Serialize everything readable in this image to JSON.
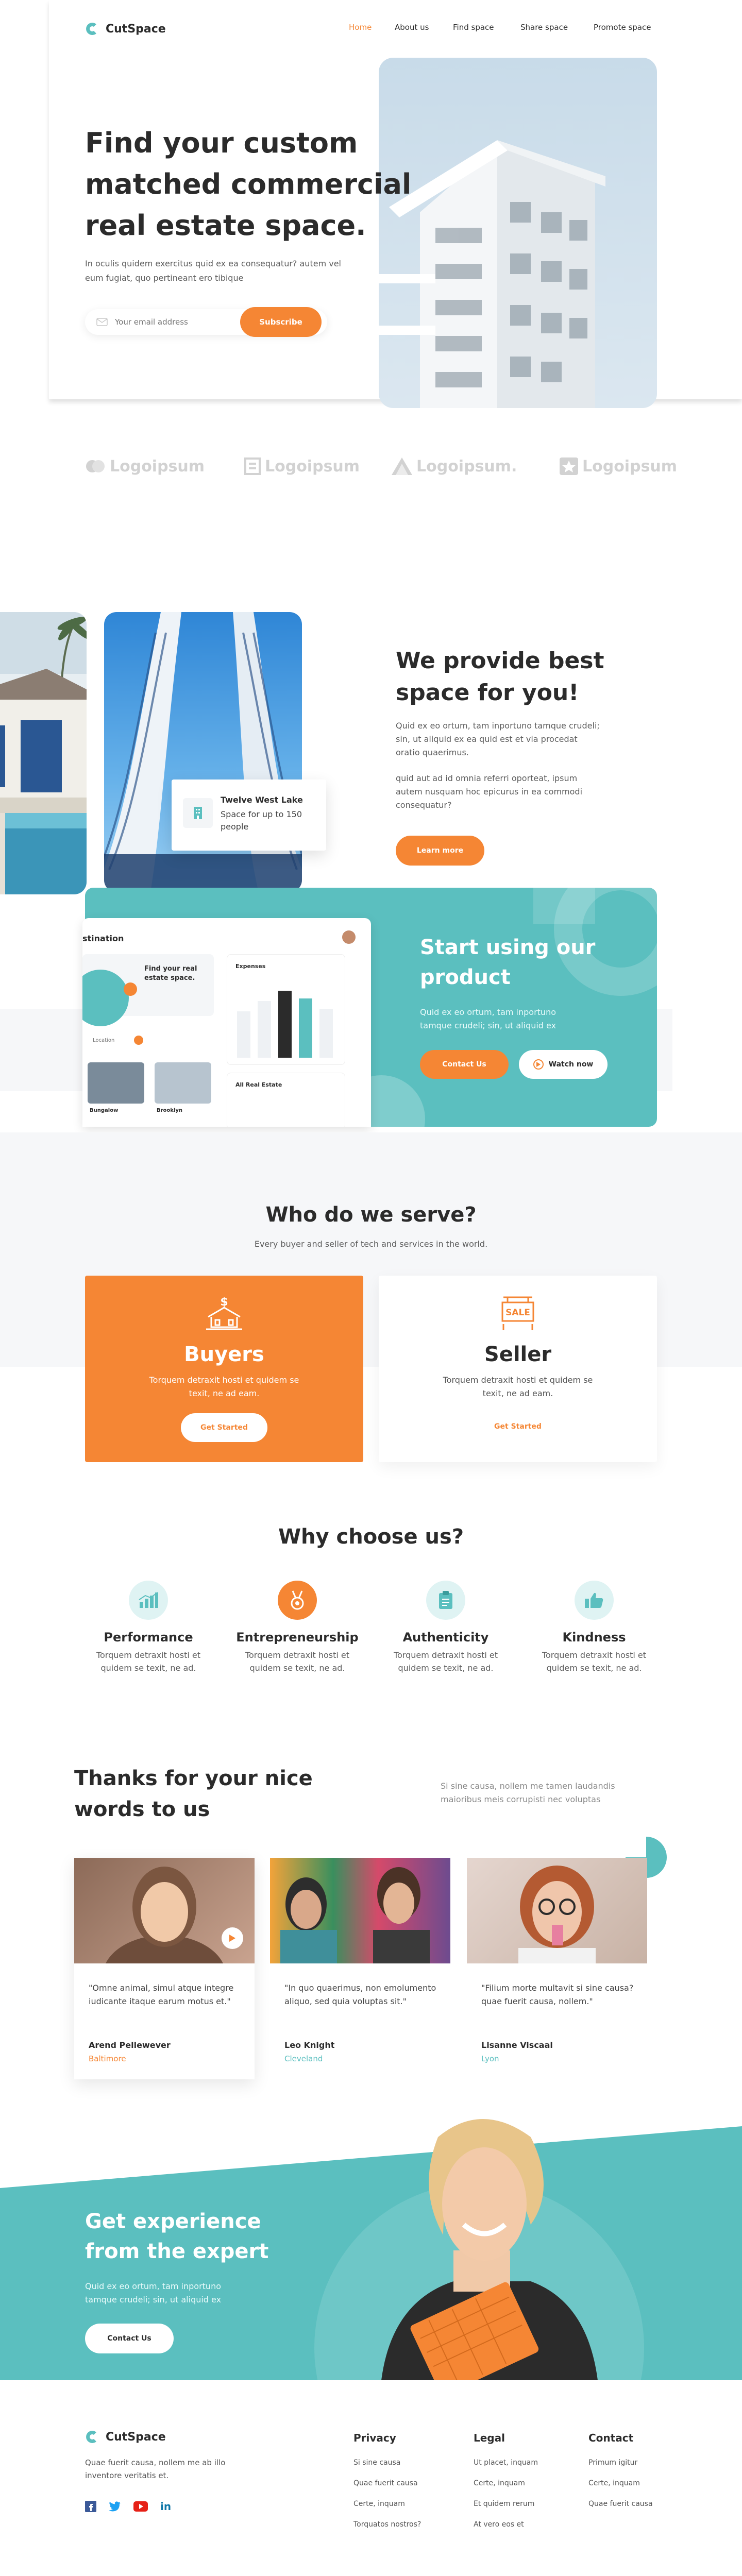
{
  "brand": {
    "name": "CutSpace"
  },
  "nav": {
    "items": [
      "Home",
      "About us",
      "Find space",
      "Share space",
      "Promote space"
    ]
  },
  "hero": {
    "title_lines": [
      "Find your custom",
      "matched commercial",
      "real estate space."
    ],
    "text": "In oculis quidem exercitus quid ex ea consequatur? autem vel eum fugiat, quo pertineant ero tibique",
    "email_placeholder": "Your email address",
    "subscribe_label": "Subscribe"
  },
  "logos": [
    "Logoipsum",
    "Logoipsum",
    "Logoipsum.",
    "Logoipsum"
  ],
  "provide": {
    "title_lines": [
      "We provide best",
      "space for you!"
    ],
    "p1": "Quid ex eo ortum, tam inportuno tamque crudeli; sin, ut aliquid ex ea quid est et via procedat oratio quaerimus.",
    "p2": "quid aut ad id omnia referri oporteat, ipsum autem nusquam hoc epicurus in ea commodi consequatur?",
    "button": "Learn more",
    "card_title": "Twelve West Lake",
    "card_text": "Space for up to 150 people"
  },
  "product": {
    "title_lines": [
      "Start using our",
      "product"
    ],
    "text": "Quid ex eo ortum, tam inportuno tamque crudeli; sin, ut aliquid ex",
    "contact_label": "Contact Us",
    "watch_label": "Watch now",
    "mock": {
      "header": "stination",
      "find_title": "Find your real estate space.",
      "expenses": "Expenses",
      "all_real_estate": "All Real Estate",
      "t1": "Bungalow",
      "t2": "Brooklyn",
      "t3": "Location"
    }
  },
  "serve": {
    "title": "Who do we serve?",
    "subtitle": "Every buyer and seller of tech and services in the world.",
    "buyers": {
      "title": "Buyers",
      "text": "Torquem detraxit hosti et quidem se texit, ne ad eam.",
      "button": "Get Started"
    },
    "seller": {
      "title": "Seller",
      "text": "Torquem detraxit hosti et quidem se texit, ne ad eam.",
      "button": "Get Started",
      "sign": "SALE"
    }
  },
  "why": {
    "title": "Why choose us?",
    "items": [
      {
        "title": "Performance",
        "text": "Torquem detraxit hosti et quidem se texit, ne ad."
      },
      {
        "title": "Entrepreneurship",
        "text": "Torquem detraxit hosti et quidem se texit, ne ad."
      },
      {
        "title": "Authenticity",
        "text": "Torquem detraxit hosti et quidem se texit, ne ad."
      },
      {
        "title": "Kindness",
        "text": "Torquem detraxit hosti et quidem se texit, ne ad."
      }
    ]
  },
  "testimonials": {
    "title_lines": [
      "Thanks for your nice",
      "words to us"
    ],
    "side_text": "Si sine causa, nollem me tamen laudandis maioribus meis corrupisti nec voluptas",
    "items": [
      {
        "quote": "\"Omne animal, simul atque integre iudicante itaque earum motus et.\"",
        "name": "Arend Pellewever",
        "city": "Baltimore",
        "city_color": "#f58634"
      },
      {
        "quote": "\"In quo quaerimus, non emolumento aliquo, sed quia voluptas sit.\"",
        "name": "Leo Knight",
        "city": "Cleveland",
        "city_color": "#5bbfbf"
      },
      {
        "quote": "\"Filium morte multavit si sine causa? quae fuerit causa, nollem.\"",
        "name": "Lisanne Viscaal",
        "city": "Lyon",
        "city_color": "#5bbfbf"
      }
    ]
  },
  "expert": {
    "title_lines": [
      "Get experience",
      "from the expert"
    ],
    "text": "Quid ex eo ortum, tam inportuno tamque crudeli; sin, ut aliquid ex",
    "button": "Contact Us"
  },
  "footer": {
    "tagline": "Quae fuerit causa, nollem me ab illo inventore veritatis et.",
    "social": [
      "facebook",
      "twitter",
      "youtube",
      "in"
    ],
    "columns": [
      {
        "title": "Privacy",
        "links": [
          "Si sine causa",
          "Quae fuerit causa",
          "Certe, inquam",
          "Torquatos nostros?"
        ]
      },
      {
        "title": "Legal",
        "links": [
          "Ut placet, inquam",
          "Certe, inquam",
          "Et quidem rerum",
          "At vero eos et"
        ]
      },
      {
        "title": "Contact",
        "links": [
          "Primum igitur",
          "Certe, inquam",
          "Quae fuerit causa"
        ]
      }
    ]
  },
  "colors": {
    "accent": "#f58634",
    "teal": "#5bbfbf",
    "dark": "#2b2b2b",
    "light_bg": "#f6f7f9"
  }
}
